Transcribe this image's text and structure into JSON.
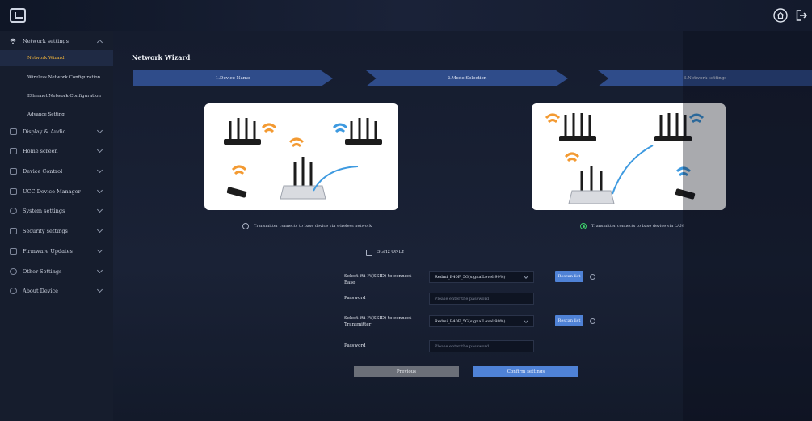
{
  "header": {
    "logo_icon": "screen-share-icon",
    "home_icon": "home-icon",
    "logout_icon": "logout-icon"
  },
  "sidebar": {
    "network": {
      "label": "Network settings",
      "sub": [
        "Network Wizard",
        "Wireless Network Configuration",
        "Ethernet Network Configuration",
        "Advance Setting"
      ]
    },
    "items": [
      {
        "label": "Display & Audio",
        "icon": "monitor-icon"
      },
      {
        "label": "Home screen",
        "icon": "home-screen-icon"
      },
      {
        "label": "Device Control",
        "icon": "device-control-icon"
      },
      {
        "label": "UCC-Device Manager",
        "icon": "device-manager-icon"
      },
      {
        "label": "System settings",
        "icon": "gear-icon"
      },
      {
        "label": "Security settings",
        "icon": "shield-icon"
      },
      {
        "label": "Firmware Updates",
        "icon": "upload-icon"
      },
      {
        "label": "Other Settings",
        "icon": "more-icon"
      },
      {
        "label": "About Device",
        "icon": "info-icon"
      }
    ]
  },
  "main": {
    "title": "Network Wizard",
    "steps": [
      "1.Device Name",
      "2.Mode Selection",
      "3.Network settings"
    ],
    "options": {
      "wireless": "Transmitter connects to base device via wireless network",
      "lan": "Transmitter connects to base device via LAN"
    },
    "five_ghz": "5GHz ONLY",
    "form": {
      "base_label": "Select Wi-Fi(SSID) to connect Base",
      "base_value": "Redmi_E40F_5G(signalLevel:99%)",
      "password_label": "Password",
      "password_placeholder": "Please enter the password",
      "tx_label": "Select Wi-Fi(SSID) to connect Transmitter",
      "tx_value": "Redmi_E40F_5G(signalLevel:99%)",
      "rescan": "Rescan list"
    },
    "buttons": {
      "previous": "Previous",
      "confirm": "Confirm settings"
    }
  },
  "colors": {
    "accent": "#4f82d6",
    "active_nav": "#f2b53a",
    "step": "#2f4c8a",
    "selected_radio": "#3dd26a"
  }
}
